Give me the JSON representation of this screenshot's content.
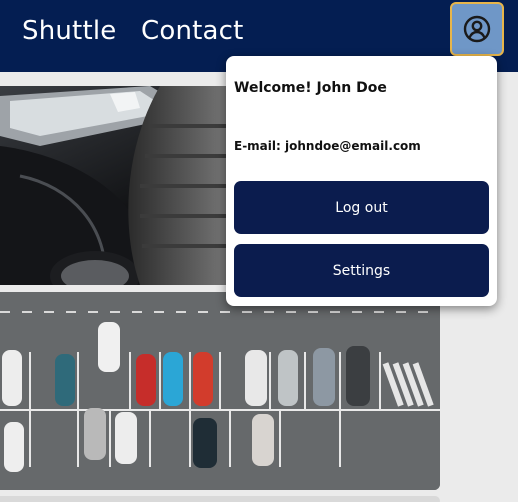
{
  "nav": {
    "links": [
      {
        "label": "Shuttle"
      },
      {
        "label": "Contact"
      }
    ],
    "profile_icon": "user-circle-icon"
  },
  "dropdown": {
    "welcome_prefix": "Welcome!",
    "user_name": "John Doe",
    "email_prefix": "E-mail:",
    "email": "johndoe@email.com",
    "logout_label": "Log out",
    "settings_label": "Settings"
  },
  "colors": {
    "nav_bg": "#041e52",
    "button_bg": "#0b1c4e",
    "profile_btn_bg": "#6f97c7",
    "profile_btn_border": "#e7b54a",
    "page_bg": "#ebebeb"
  }
}
